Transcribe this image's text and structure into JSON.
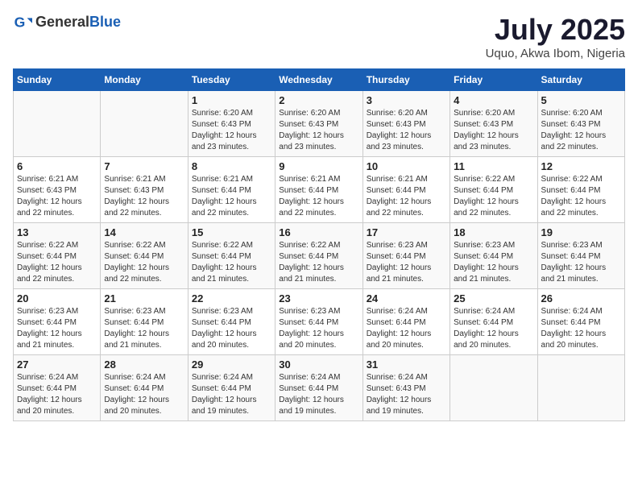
{
  "header": {
    "logo_general": "General",
    "logo_blue": "Blue",
    "title": "July 2025",
    "subtitle": "Uquo, Akwa Ibom, Nigeria"
  },
  "calendar": {
    "days_of_week": [
      "Sunday",
      "Monday",
      "Tuesday",
      "Wednesday",
      "Thursday",
      "Friday",
      "Saturday"
    ],
    "weeks": [
      [
        {
          "day": "",
          "info": ""
        },
        {
          "day": "",
          "info": ""
        },
        {
          "day": "1",
          "info": "Sunrise: 6:20 AM\nSunset: 6:43 PM\nDaylight: 12 hours and 23 minutes."
        },
        {
          "day": "2",
          "info": "Sunrise: 6:20 AM\nSunset: 6:43 PM\nDaylight: 12 hours and 23 minutes."
        },
        {
          "day": "3",
          "info": "Sunrise: 6:20 AM\nSunset: 6:43 PM\nDaylight: 12 hours and 23 minutes."
        },
        {
          "day": "4",
          "info": "Sunrise: 6:20 AM\nSunset: 6:43 PM\nDaylight: 12 hours and 23 minutes."
        },
        {
          "day": "5",
          "info": "Sunrise: 6:20 AM\nSunset: 6:43 PM\nDaylight: 12 hours and 22 minutes."
        }
      ],
      [
        {
          "day": "6",
          "info": "Sunrise: 6:21 AM\nSunset: 6:43 PM\nDaylight: 12 hours and 22 minutes."
        },
        {
          "day": "7",
          "info": "Sunrise: 6:21 AM\nSunset: 6:43 PM\nDaylight: 12 hours and 22 minutes."
        },
        {
          "day": "8",
          "info": "Sunrise: 6:21 AM\nSunset: 6:44 PM\nDaylight: 12 hours and 22 minutes."
        },
        {
          "day": "9",
          "info": "Sunrise: 6:21 AM\nSunset: 6:44 PM\nDaylight: 12 hours and 22 minutes."
        },
        {
          "day": "10",
          "info": "Sunrise: 6:21 AM\nSunset: 6:44 PM\nDaylight: 12 hours and 22 minutes."
        },
        {
          "day": "11",
          "info": "Sunrise: 6:22 AM\nSunset: 6:44 PM\nDaylight: 12 hours and 22 minutes."
        },
        {
          "day": "12",
          "info": "Sunrise: 6:22 AM\nSunset: 6:44 PM\nDaylight: 12 hours and 22 minutes."
        }
      ],
      [
        {
          "day": "13",
          "info": "Sunrise: 6:22 AM\nSunset: 6:44 PM\nDaylight: 12 hours and 22 minutes."
        },
        {
          "day": "14",
          "info": "Sunrise: 6:22 AM\nSunset: 6:44 PM\nDaylight: 12 hours and 22 minutes."
        },
        {
          "day": "15",
          "info": "Sunrise: 6:22 AM\nSunset: 6:44 PM\nDaylight: 12 hours and 21 minutes."
        },
        {
          "day": "16",
          "info": "Sunrise: 6:22 AM\nSunset: 6:44 PM\nDaylight: 12 hours and 21 minutes."
        },
        {
          "day": "17",
          "info": "Sunrise: 6:23 AM\nSunset: 6:44 PM\nDaylight: 12 hours and 21 minutes."
        },
        {
          "day": "18",
          "info": "Sunrise: 6:23 AM\nSunset: 6:44 PM\nDaylight: 12 hours and 21 minutes."
        },
        {
          "day": "19",
          "info": "Sunrise: 6:23 AM\nSunset: 6:44 PM\nDaylight: 12 hours and 21 minutes."
        }
      ],
      [
        {
          "day": "20",
          "info": "Sunrise: 6:23 AM\nSunset: 6:44 PM\nDaylight: 12 hours and 21 minutes."
        },
        {
          "day": "21",
          "info": "Sunrise: 6:23 AM\nSunset: 6:44 PM\nDaylight: 12 hours and 21 minutes."
        },
        {
          "day": "22",
          "info": "Sunrise: 6:23 AM\nSunset: 6:44 PM\nDaylight: 12 hours and 20 minutes."
        },
        {
          "day": "23",
          "info": "Sunrise: 6:23 AM\nSunset: 6:44 PM\nDaylight: 12 hours and 20 minutes."
        },
        {
          "day": "24",
          "info": "Sunrise: 6:24 AM\nSunset: 6:44 PM\nDaylight: 12 hours and 20 minutes."
        },
        {
          "day": "25",
          "info": "Sunrise: 6:24 AM\nSunset: 6:44 PM\nDaylight: 12 hours and 20 minutes."
        },
        {
          "day": "26",
          "info": "Sunrise: 6:24 AM\nSunset: 6:44 PM\nDaylight: 12 hours and 20 minutes."
        }
      ],
      [
        {
          "day": "27",
          "info": "Sunrise: 6:24 AM\nSunset: 6:44 PM\nDaylight: 12 hours and 20 minutes."
        },
        {
          "day": "28",
          "info": "Sunrise: 6:24 AM\nSunset: 6:44 PM\nDaylight: 12 hours and 20 minutes."
        },
        {
          "day": "29",
          "info": "Sunrise: 6:24 AM\nSunset: 6:44 PM\nDaylight: 12 hours and 19 minutes."
        },
        {
          "day": "30",
          "info": "Sunrise: 6:24 AM\nSunset: 6:44 PM\nDaylight: 12 hours and 19 minutes."
        },
        {
          "day": "31",
          "info": "Sunrise: 6:24 AM\nSunset: 6:43 PM\nDaylight: 12 hours and 19 minutes."
        },
        {
          "day": "",
          "info": ""
        },
        {
          "day": "",
          "info": ""
        }
      ]
    ]
  }
}
